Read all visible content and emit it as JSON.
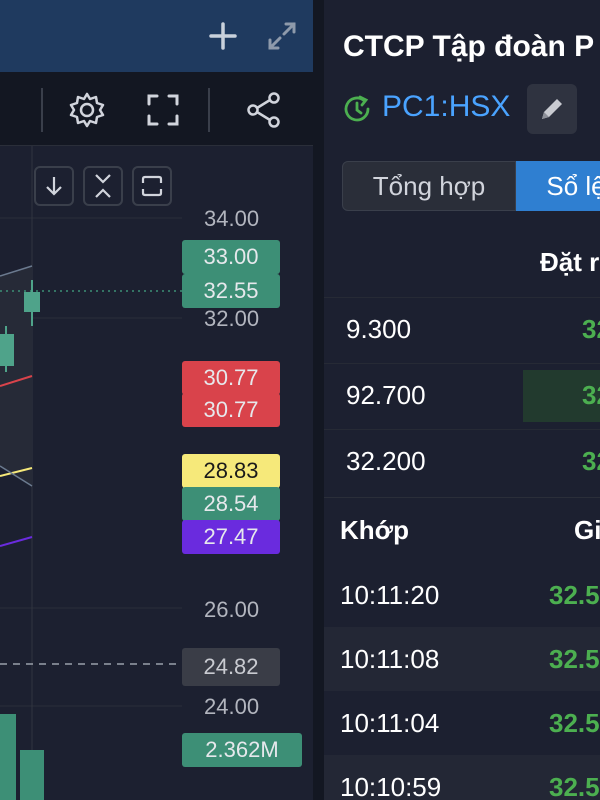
{
  "chart_panel": {
    "axis_labels": [
      "34.00",
      "32.00",
      "26.00",
      "24.00"
    ],
    "price_tags": [
      {
        "text": "33.00",
        "color": "#3d8f76"
      },
      {
        "text": "32.55",
        "color": "#3d8f76"
      },
      {
        "text": "30.77",
        "color": "#d9434b"
      },
      {
        "text": "30.77",
        "color": "#d9434b"
      },
      {
        "text": "28.83",
        "color": "#f6e97a"
      },
      {
        "text": "28.54",
        "color": "#3d8f76"
      },
      {
        "text": "27.47",
        "color": "#6a2bde"
      },
      {
        "text": "24.82",
        "color": "#3a3d47"
      }
    ],
    "volume_tag": "2.362M",
    "icons": [
      "plus-icon",
      "expand-icon",
      "gear-icon",
      "fullscreen-icon",
      "share-icon",
      "arrow-down-icon",
      "collapse-icon",
      "frame-icon"
    ]
  },
  "stock": {
    "title": "CTCP Tập đoàn P",
    "symbol": "PC1:HSX"
  },
  "tabs": [
    "Tổng hợp",
    "Sổ lệ"
  ],
  "order_book": {
    "header": "Đặt r",
    "rows": [
      {
        "volume": "9.300",
        "price": "32"
      },
      {
        "volume": "92.700",
        "price": "32"
      },
      {
        "volume": "32.200",
        "price": "32"
      }
    ]
  },
  "matches": {
    "header_left": "Khớp",
    "header_right": "Gi",
    "rows": [
      {
        "time": "10:11:20",
        "price": "32.5"
      },
      {
        "time": "10:11:08",
        "price": "32.5"
      },
      {
        "time": "10:11:04",
        "price": "32.5"
      },
      {
        "time": "10:10:59",
        "price": "32.5"
      }
    ]
  },
  "colors": {
    "up": "#4caf50",
    "accent": "#2f7fd1",
    "header_blue": "#1f3a5f"
  }
}
